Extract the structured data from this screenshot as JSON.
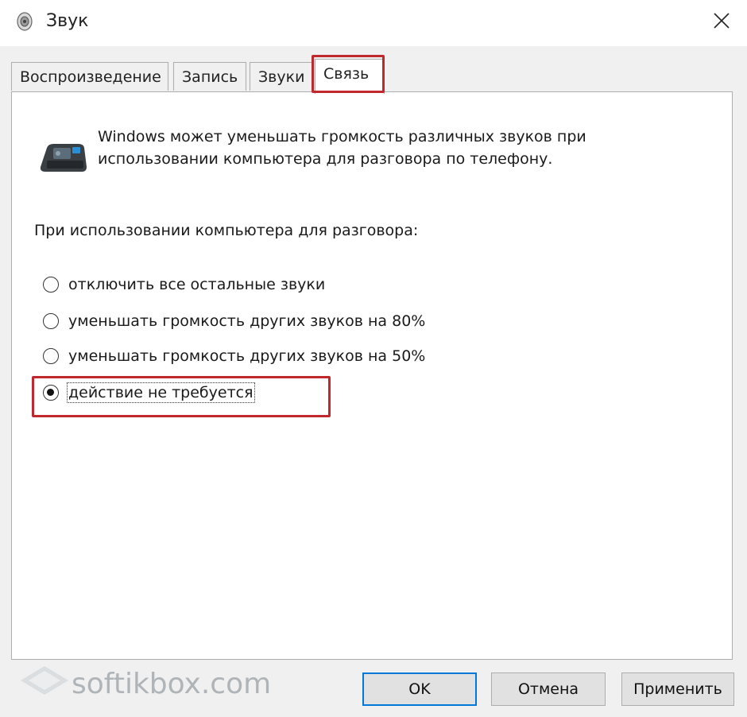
{
  "window": {
    "title": "Звук",
    "close_label": "✕"
  },
  "tabs": [
    {
      "label": "Воспроизведение",
      "active": false
    },
    {
      "label": "Запись",
      "active": false
    },
    {
      "label": "Звуки",
      "active": false
    },
    {
      "label": "Связь",
      "active": true
    }
  ],
  "panel": {
    "description_line1": "Windows может уменьшать громкость различных звуков при",
    "description_line2": "использовании компьютера для разговора по телефону.",
    "subheading": "При использовании компьютера для разговора:",
    "options": [
      {
        "label": "отключить все остальные звуки",
        "checked": false
      },
      {
        "label": "уменьшать громкость других звуков на 80%",
        "checked": false
      },
      {
        "label": "уменьшать громкость других звуков на 50%",
        "checked": false
      },
      {
        "label": "действие не требуется",
        "checked": true
      }
    ]
  },
  "buttons": {
    "ok": "OK",
    "cancel": "Отмена",
    "apply": "Применить"
  },
  "watermark": {
    "text": "softikbox.com"
  },
  "colors": {
    "highlight": "#c0282e",
    "default_button_border": "#0078d7"
  }
}
